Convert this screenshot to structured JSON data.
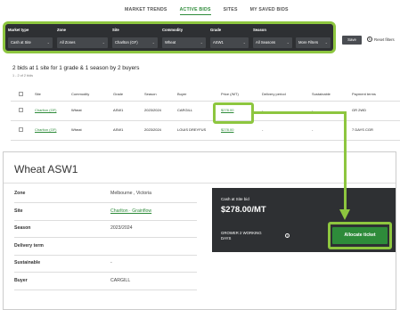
{
  "tabs": [
    {
      "label": "MARKET TRENDS"
    },
    {
      "label": "ACTIVE BIDS"
    },
    {
      "label": "SITES"
    },
    {
      "label": "MY SAVED BIDS"
    }
  ],
  "filters": {
    "labels": [
      "Market type",
      "Zone",
      "Site",
      "Commodity",
      "Grade",
      "Season"
    ],
    "values": [
      "Cash at Site",
      "All Zones",
      "Charlton (GF)",
      "Wheat",
      "ASW1",
      "All Seasons"
    ],
    "more_filters": "More Filters",
    "save": "Save",
    "reset": "Reset filters"
  },
  "summary": "2 bids at 1 site for 1 grade & 1 season by 2 buyers",
  "sub_summary": "1 - 2 of 2 bids",
  "table": {
    "headers": [
      "Site",
      "Commodity",
      "Grade",
      "Season",
      "Buyer",
      "Price (/MT)",
      "Delivery period",
      "Sustainable",
      "Payment terms"
    ],
    "rows": [
      [
        "Charlton (GF)",
        "Wheat",
        "ASW1",
        "2023/2024",
        "CARGILL",
        "$278.00",
        "-",
        "-",
        "GR 2WD"
      ],
      [
        "Charlton (GF)",
        "Wheat",
        "ASW1",
        "2023/2024",
        "LOUIS DREYFUS",
        "$278.00",
        "-",
        "-",
        "7 DAYS CGR"
      ]
    ]
  },
  "detail": {
    "title": "Wheat ASW1",
    "rows": [
      {
        "k": "Zone",
        "v": "Melbourne , Victoria"
      },
      {
        "k": "Site",
        "v": "Charlton · Grainflow"
      },
      {
        "k": "Season",
        "v": "2023/2024"
      },
      {
        "k": "Delivery term",
        "v": ""
      },
      {
        "k": "Sustainable",
        "v": "-"
      },
      {
        "k": "Buyer",
        "v": "CARGILL"
      }
    ]
  },
  "card": {
    "label": "Cash at Site bid",
    "price": "$278.00/MT",
    "grower": "GROWER 2 WORKING DAYS",
    "allocate": "Allocate ticket"
  },
  "colors": {
    "accent": "#2e8b3a",
    "highlight": "#8dc63f",
    "dark": "#2e3033"
  }
}
